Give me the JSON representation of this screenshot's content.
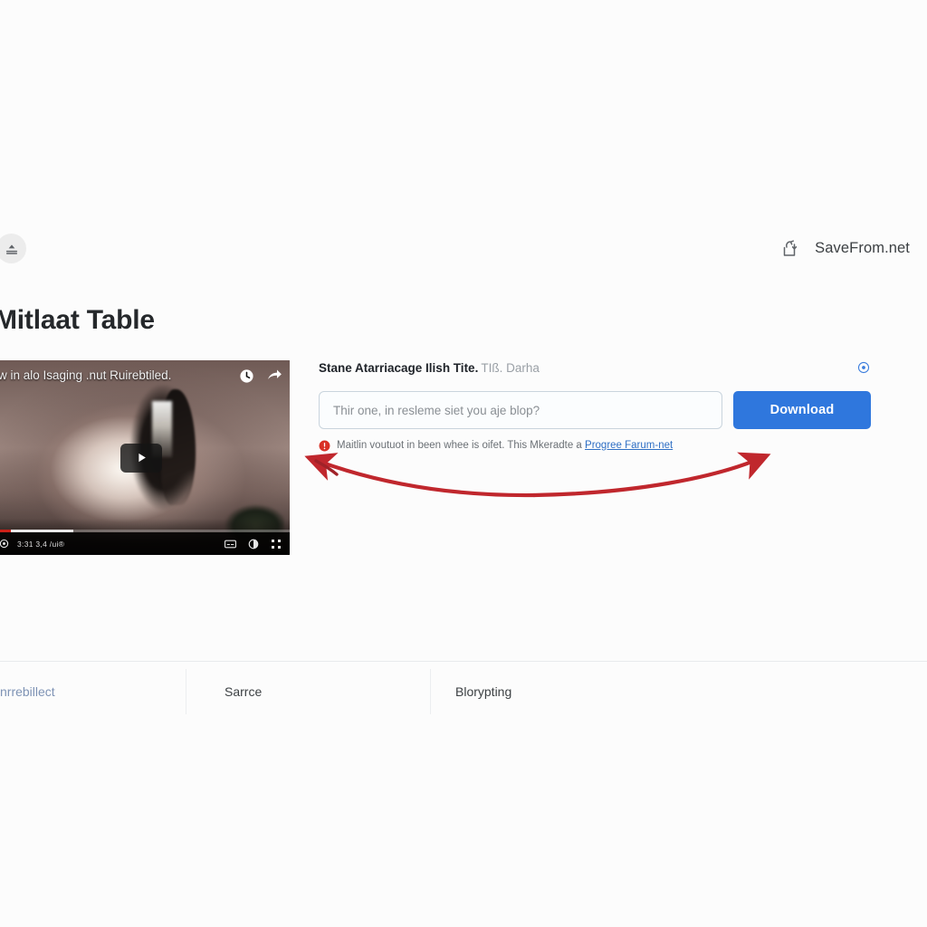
{
  "header": {
    "upload_icon": "upload-cloud-icon",
    "brand_icon": "savefrom-logo-icon",
    "brand_name": "SaveFrom.net"
  },
  "page_title": "Mitlaat Table",
  "player": {
    "video_title": "w in alo Isaging .nut Ruirebtiled.",
    "watch_later_icon": "clock-icon",
    "share_icon": "share-arrow-icon",
    "play_icon": "play-icon",
    "time_text": "3:31 3,4 /ui®",
    "settings_icon": "settings-icon",
    "subtitles_icon": "subtitles-icon",
    "miniplayer_icon": "miniplayer-icon",
    "fullscreen_icon": "fullscreen-icon",
    "progress_played_percent": 6,
    "progress_buffered_percent": 27
  },
  "form": {
    "heading_strong": "Stane Atarriacage Ilish Tite.",
    "heading_muted": "TIß. Darha",
    "info_icon": "info-circle-icon",
    "input_placeholder": "Thir one, in resleme siet you aje blop?",
    "input_value": "",
    "download_label": "Download",
    "error_icon": "error-circle-icon",
    "error_text": "Maitlin voutuot in been whee is oifet. This Mkeradte a",
    "error_link": "Progree Farum-net"
  },
  "annotation": {
    "arrow_color": "#c0272d",
    "arrow_type": "double-headed-curved-arrow"
  },
  "footer": {
    "items": [
      {
        "label": "nrrebillect",
        "style": "link"
      },
      {
        "label": "Sarrce",
        "style": "text"
      },
      {
        "label": "Blorypting",
        "style": "text"
      }
    ]
  },
  "colors": {
    "accent_blue": "#2f77dd",
    "link_blue": "#2f6fc4",
    "annotation_red": "#c0272d",
    "page_bg": "#fcfcfc",
    "progress_red": "#cc2018"
  }
}
